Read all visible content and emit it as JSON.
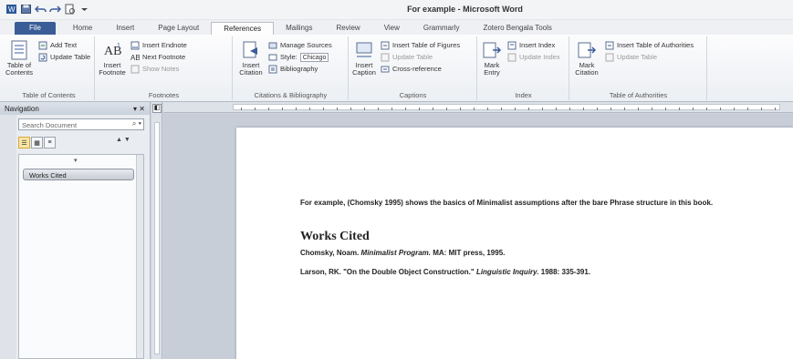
{
  "window": {
    "title": "For example - Microsoft Word"
  },
  "quick_access": {
    "icons": [
      "word-app-icon",
      "save-icon",
      "undo-icon",
      "redo-icon",
      "print-preview-icon",
      "customize-qat-icon"
    ]
  },
  "tabs": [
    {
      "label": "File",
      "kind": "file"
    },
    {
      "label": "Home"
    },
    {
      "label": "Insert"
    },
    {
      "label": "Page Layout"
    },
    {
      "label": "References",
      "active": true
    },
    {
      "label": "Mailings"
    },
    {
      "label": "Review"
    },
    {
      "label": "View"
    },
    {
      "label": "Grammarly"
    },
    {
      "label": "Zotero Bengala Tools"
    }
  ],
  "ribbon": {
    "toc": {
      "label": "Table of Contents",
      "btn": "Table of Contents",
      "add_text": "Add Text",
      "update": "Update Table"
    },
    "footnotes": {
      "label": "Footnotes",
      "insert": "Insert Footnote",
      "insert_endnote": "Insert Endnote",
      "next": "Next Footnote",
      "show": "Show Notes"
    },
    "citations": {
      "label": "Citations & Bibliography",
      "insert": "Insert Citation",
      "manage": "Manage Sources",
      "style": "Style:",
      "style_value": "Chicago",
      "bibliography": "Bibliography"
    },
    "captions": {
      "label": "Captions",
      "insert": "Insert Caption",
      "table_of_figures": "Insert Table of Figures",
      "update": "Update Table",
      "cross_ref": "Cross-reference"
    },
    "index": {
      "label": "Index",
      "mark": "Mark Entry",
      "insert": "Insert Index",
      "update": "Update Index"
    },
    "toa": {
      "label": "Table of Authorities",
      "mark": "Mark Citation",
      "insert": "Insert Table of Authorities",
      "update": "Update Table"
    }
  },
  "nav": {
    "title": "Navigation",
    "search_placeholder": "Search Document",
    "selected_heading": "Works Cited"
  },
  "document": {
    "para1": "For example, (Chomsky 1995) shows the basics of Minimalist assumptions after the bare Phrase structure in this book.",
    "heading": "Works Cited",
    "ref1_prefix": "Chomsky, Noam. ",
    "ref1_title": "Minimalist Program.",
    "ref1_suffix": " MA: MIT press, 1995.",
    "ref2_prefix": "Larson, RK. \"On the Double Object Construction.\" ",
    "ref2_journal": "Linguistic Inquiry.",
    "ref2_suffix": " 1988: 335-391."
  },
  "colors": {
    "file_tab": "#3a5d97",
    "ribbon_bg": "#f4f6f8",
    "doc_bg": "#c7ced8",
    "selected_view": "#fbe5a7"
  }
}
